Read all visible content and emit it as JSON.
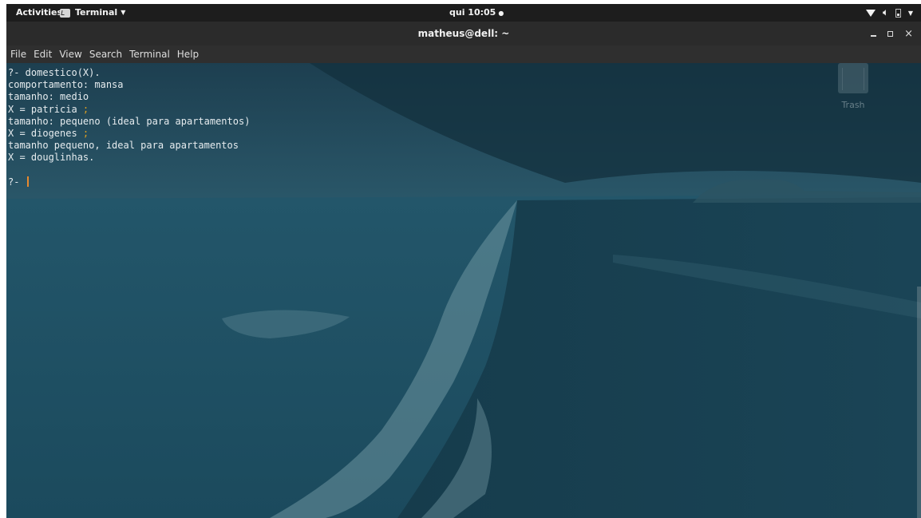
{
  "topbar": {
    "activities": "Activities",
    "app_menu": "Terminal",
    "clock": "qui 10:05",
    "clock_dot": "●"
  },
  "window": {
    "title": "matheus@dell: ~"
  },
  "menubar": {
    "items": [
      "File",
      "Edit",
      "View",
      "Search",
      "Terminal",
      "Help"
    ]
  },
  "terminal": {
    "lines": [
      "?- domestico(X).",
      "comportamento: mansa",
      "tamanho: medio",
      "X = patricia ",
      "tamanho: pequeno (ideal para apartamentos)",
      "X = diogenes ",
      "tamanho pequeno, ideal para apartamentos",
      "X = douglinhas.",
      "",
      "?- "
    ],
    "semicolon": ";",
    "cursor_color": "#e8892e"
  },
  "desktop": {
    "trash_label": "Trash"
  },
  "colors": {
    "topbar_bg": "#1d1d1d",
    "titlebar_bg": "#2b2b2b",
    "menubar_bg": "#2f2f2f",
    "terminal_tint": "#1f4a5c"
  }
}
